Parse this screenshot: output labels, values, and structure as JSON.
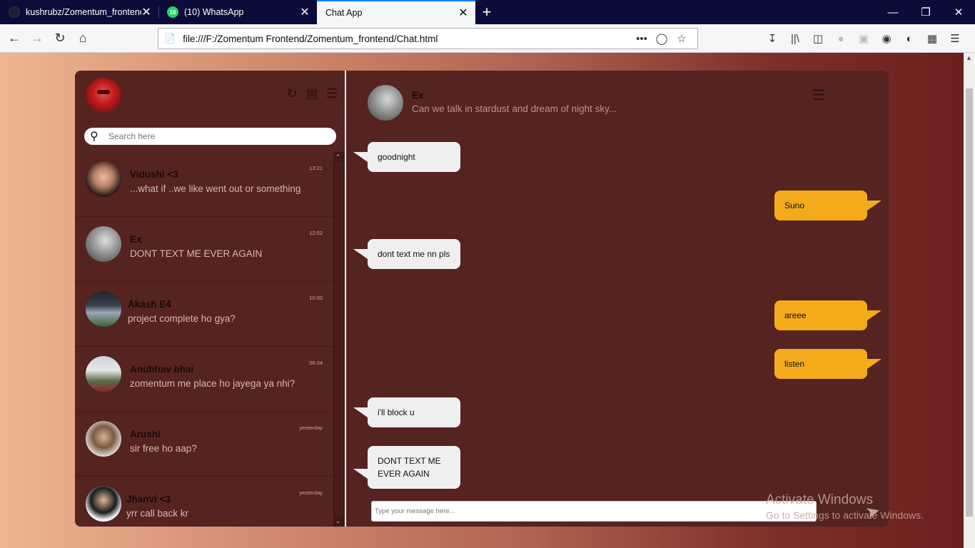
{
  "browser": {
    "tabs": [
      {
        "title": "kushrubz/Zomentum_frontend",
        "close": "✕",
        "favicon": "github-icon"
      },
      {
        "title": "(10) WhatsApp",
        "close": "✕",
        "favicon": "whatsapp-icon",
        "badge": "10"
      },
      {
        "title": "Chat App",
        "close": "✕",
        "favicon": "none"
      }
    ],
    "new_tab": "+",
    "url": "file:///F:/Zomentum Frontend/Zomentum_frontend/Chat.html"
  },
  "sidebar": {
    "search_placeholder": "Search here",
    "chats": [
      {
        "name": "Vidushi <3",
        "preview": "...what if ..we like went out or something",
        "time": "13:21"
      },
      {
        "name": "Ex",
        "preview": "DONT TEXT ME EVER AGAIN",
        "time": "12:02"
      },
      {
        "name": "Akash E4",
        "preview": "project complete ho gya?",
        "time": "10:00"
      },
      {
        "name": "Anubhav bhai",
        "preview": "zomentum me place ho jayega ya nhi?",
        "time": "06:34"
      },
      {
        "name": "Arushi",
        "preview": "sir free ho aap?",
        "time": "yesterday"
      },
      {
        "name": "Jhanvi <3",
        "preview": "yrr call back kr",
        "time": "yesterday"
      }
    ]
  },
  "chat": {
    "contact_name": "Ex",
    "contact_status": "Can we talk in stardust and dream of night sky...",
    "messages": [
      {
        "dir": "in",
        "text": "goodnight"
      },
      {
        "dir": "out",
        "text": "Suno"
      },
      {
        "dir": "in",
        "text": "dont text me nn pls"
      },
      {
        "dir": "out",
        "text": "areee"
      },
      {
        "dir": "out",
        "text": "listen"
      },
      {
        "dir": "in",
        "text": "i'll block u"
      },
      {
        "dir": "in",
        "text": "DONT TEXT ME EVER AGAIN"
      }
    ],
    "composer_placeholder": "Type your message here..."
  },
  "watermark": {
    "line1": "Activate Windows",
    "line2": "Go to Settings to activate Windows."
  },
  "colors": {
    "panel": "#552320",
    "outgoing_bubble": "#f3ab1b",
    "incoming_bubble": "#efefef"
  }
}
